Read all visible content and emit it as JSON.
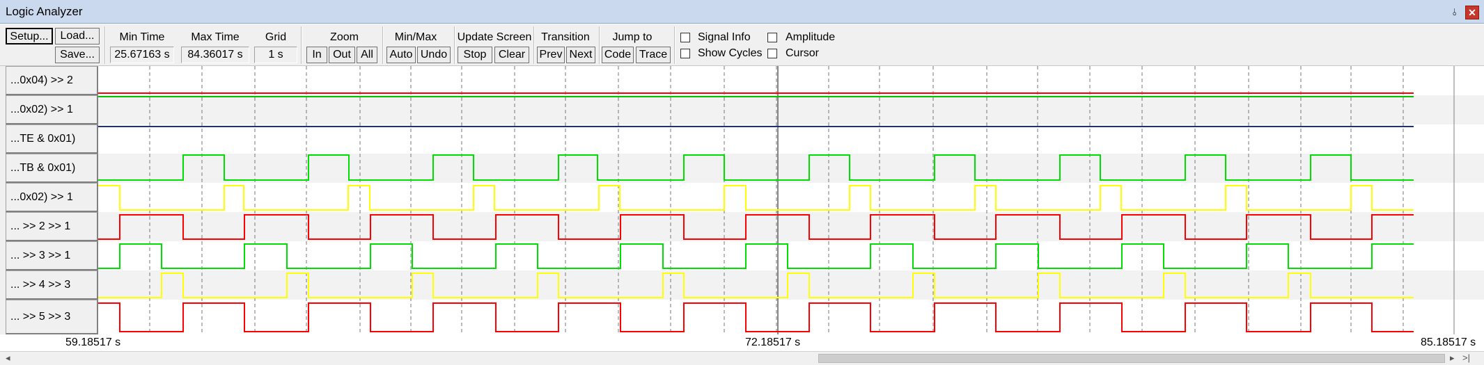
{
  "window": {
    "title": "Logic Analyzer",
    "pin_icon": "pin-icon",
    "close_icon": "close-icon"
  },
  "toolbar": {
    "setup": "Setup...",
    "load": "Load...",
    "save": "Save...",
    "min_time_label": "Min Time",
    "min_time": "25.67163 s",
    "max_time_label": "Max Time",
    "max_time": "84.36017 s",
    "grid_label": "Grid",
    "grid": "1 s",
    "zoom_label": "Zoom",
    "zoom_in": "In",
    "zoom_out": "Out",
    "zoom_all": "All",
    "minmax_label": "Min/Max",
    "auto": "Auto",
    "undo": "Undo",
    "update_label": "Update Screen",
    "stop": "Stop",
    "clear": "Clear",
    "transition_label": "Transition",
    "prev": "Prev",
    "next": "Next",
    "jump_label": "Jump to",
    "code": "Code",
    "trace": "Trace",
    "signal_info": "Signal Info",
    "amplitude": "Amplitude",
    "show_cycles": "Show Cycles",
    "cursor": "Cursor"
  },
  "signals": [
    {
      "name": "...0x04) >> 2",
      "color": "#ff0000"
    },
    {
      "name": "...0x02) >> 1",
      "color": "#000080"
    },
    {
      "name": "...TE & 0x01)",
      "color": "#000080"
    },
    {
      "name": "...TB & 0x01)",
      "color": "#00e000"
    },
    {
      "name": "...0x02) >> 1",
      "color": "#ffff00"
    },
    {
      "name": "... >> 2 >> 1",
      "color": "#ff0000"
    },
    {
      "name": "... >> 3 >> 1",
      "color": "#00e000"
    },
    {
      "name": "... >> 4 >> 3",
      "color": "#ffff00"
    },
    {
      "name": "... >> 5 >> 3",
      "color": "#ff0000"
    }
  ],
  "time_axis": {
    "start": "59.18517 s",
    "cursor": "72.18517 s",
    "end": "85.18517 s"
  }
}
